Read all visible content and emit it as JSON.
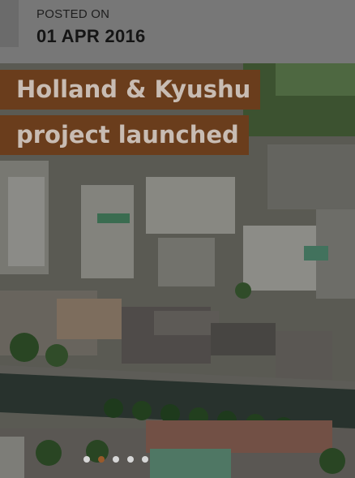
{
  "post": {
    "posted_label": "POSTED ON",
    "date": "01 APR 2016",
    "title_line_1": "Holland & Kyushu",
    "title_line_2": "project launched"
  },
  "slider": {
    "active_index": 1,
    "dots": 5
  },
  "colors": {
    "header_bg": "#777777",
    "title_bg": "#6a3d1c",
    "title_text": "#c8bcb3",
    "active_dot": "#9a5a2a"
  }
}
